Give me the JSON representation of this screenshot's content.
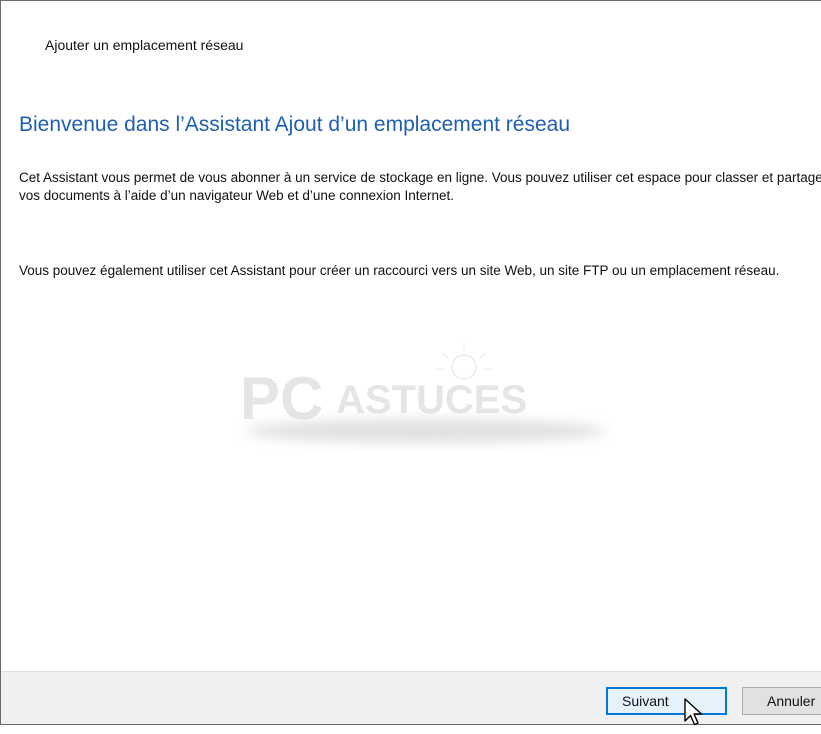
{
  "window": {
    "title": "Ajouter un emplacement réseau"
  },
  "main": {
    "heading": "Bienvenue dans l’Assistant Ajout d’un emplacement réseau",
    "paragraph1": "Cet Assistant vous permet de vous abonner à un service de stockage en ligne. Vous pouvez utiliser cet espace pour classer et partager vos documents à l’aide d’un navigateur Web et d’une connexion Internet.",
    "paragraph2": "Vous pouvez également utiliser cet Assistant pour créer un raccourci vers un site Web, un site FTP ou un emplacement réseau."
  },
  "watermark": {
    "text_pc": "PC",
    "text_astuces": "ASTUCES",
    "icon": "lightbulb-icon"
  },
  "footer": {
    "next_label": "Suivant",
    "cancel_label": "Annuler"
  },
  "cursor": {
    "icon": "mouse-pointer-icon"
  },
  "colors": {
    "heading": "#1e5fb4",
    "footer_bg": "#f0f0f0",
    "default_button_border": "#0078d7"
  }
}
